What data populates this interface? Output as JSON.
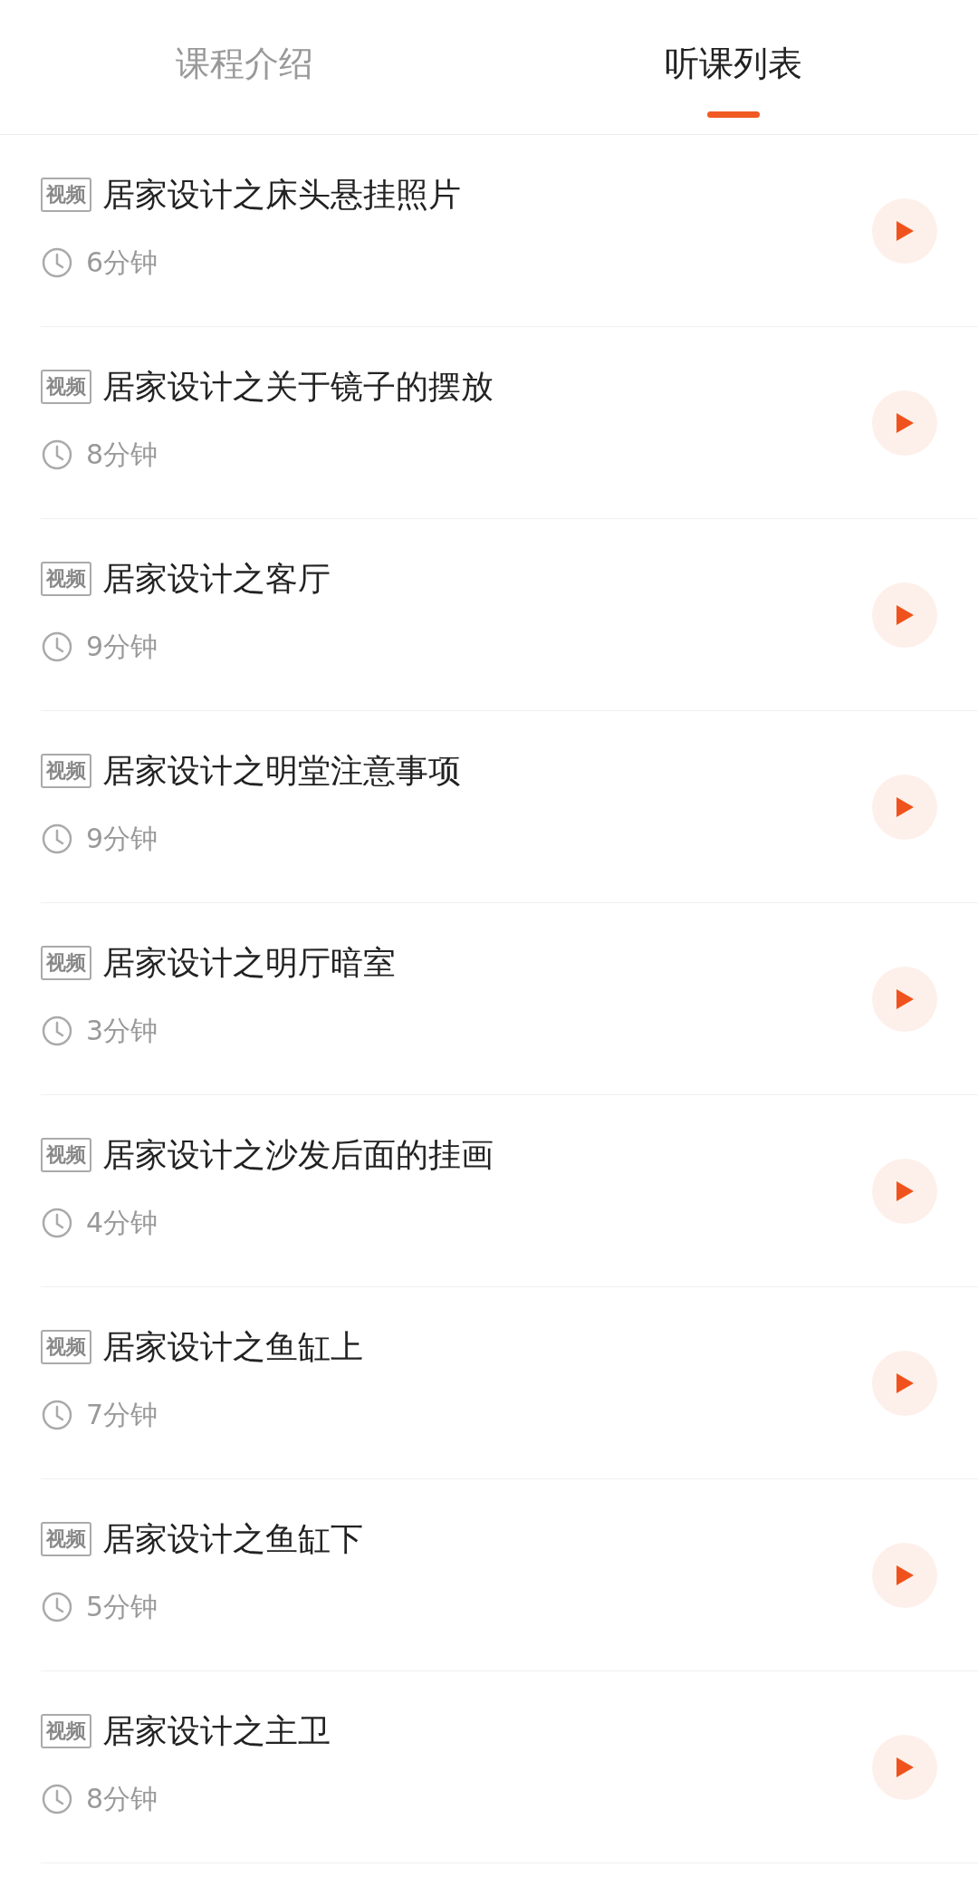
{
  "tabs": [
    {
      "label": "课程介绍",
      "selected": false
    },
    {
      "label": "听课列表",
      "selected": true
    }
  ],
  "lessons": [
    {
      "badge": "视频",
      "title": "居家设计之床头悬挂照片",
      "duration": "6分钟"
    },
    {
      "badge": "视频",
      "title": "居家设计之关于镜子的摆放",
      "duration": "8分钟"
    },
    {
      "badge": "视频",
      "title": "居家设计之客厅",
      "duration": "9分钟"
    },
    {
      "badge": "视频",
      "title": "居家设计之明堂注意事项",
      "duration": "9分钟"
    },
    {
      "badge": "视频",
      "title": "居家设计之明厅暗室",
      "duration": "3分钟"
    },
    {
      "badge": "视频",
      "title": "居家设计之沙发后面的挂画",
      "duration": "4分钟"
    },
    {
      "badge": "视频",
      "title": "居家设计之鱼缸上",
      "duration": "7分钟"
    },
    {
      "badge": "视频",
      "title": "居家设计之鱼缸下",
      "duration": "5分钟"
    },
    {
      "badge": "视频",
      "title": "居家设计之主卫",
      "duration": "8分钟"
    }
  ]
}
